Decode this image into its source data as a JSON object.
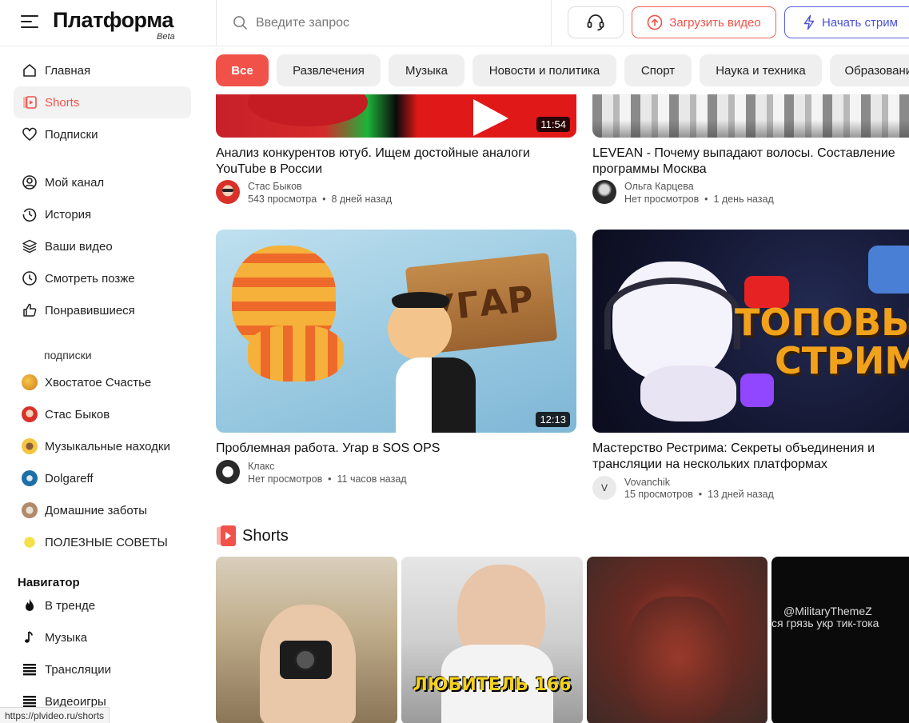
{
  "header": {
    "logo": "Платформа",
    "beta": "Beta",
    "search_placeholder": "Введите запрос",
    "upload_label": "Загрузить видео",
    "stream_label": "Начать стрим"
  },
  "sidebar": {
    "main_items": [
      {
        "label": "Главная",
        "icon": "home-icon"
      },
      {
        "label": "Shorts",
        "icon": "shorts-icon",
        "active": true
      },
      {
        "label": "Подписки",
        "icon": "heart-icon"
      }
    ],
    "library_items": [
      {
        "label": "Мой канал",
        "icon": "user-circle-icon"
      },
      {
        "label": "История",
        "icon": "history-icon"
      },
      {
        "label": "Ваши видео",
        "icon": "layers-icon"
      },
      {
        "label": "Смотреть позже",
        "icon": "clock-icon"
      },
      {
        "label": "Понравившиеся",
        "icon": "thumb-up-icon"
      }
    ],
    "subs_label": "подписки",
    "subscriptions": [
      {
        "label": "Хвостатое Счастье",
        "color": "#e8a020"
      },
      {
        "label": "Стас Быков",
        "color": "#d9302a"
      },
      {
        "label": "Музыкальные находки",
        "color": "#f4c542"
      },
      {
        "label": "Dolgareff",
        "color": "#1e6fa8"
      },
      {
        "label": "Домашние заботы",
        "color": "#c9a27a"
      },
      {
        "label": "ПОЛЕЗНЫЕ СОВЕТЫ",
        "color": "#f5e04a"
      }
    ],
    "navigator_label": "Навигатор",
    "navigator_items": [
      {
        "label": "В тренде",
        "icon": "flame-icon"
      },
      {
        "label": "Музыка",
        "icon": "music-note-icon"
      },
      {
        "label": "Трансляции",
        "icon": "broadcast-icon"
      },
      {
        "label": "Видеоигры",
        "icon": "gamepad-icon"
      }
    ]
  },
  "chips": [
    "Все",
    "Развлечения",
    "Музыка",
    "Новости и политика",
    "Спорт",
    "Наука и техника",
    "Образование"
  ],
  "videos": [
    {
      "title": "Анализ конкурентов ютуб. Ищем достойные аналоги YouTube в России",
      "author": "Стас Быков",
      "views": "543 просмотра",
      "age": "8 дней назад",
      "duration": "11:54"
    },
    {
      "title": "LEVEAN - Почему выпадают волосы. Составление программы Москва",
      "author": "Ольга Карцева",
      "views": "Нет просмотров",
      "age": "1 день назад",
      "duration": ""
    },
    {
      "title": "Проблемная работа. Угар в SOS OPS",
      "author": "Клакс",
      "views": "Нет просмотров",
      "age": "11 часов назад",
      "duration": "12:13",
      "thumb_text": "УГАР"
    },
    {
      "title": "Мастерство Рестрима: Секреты объединения и трансляции на нескольких платформах",
      "author": "Vovanchik",
      "avatar_letter": "V",
      "views": "15 просмотров",
      "age": "13 дней назад",
      "duration": "",
      "thumb_text_1": "ТОПОВЫ",
      "thumb_text_2": "СТРИМ"
    }
  ],
  "shorts": {
    "title": "Shorts",
    "items": [
      {
        "overlay": ""
      },
      {
        "overlay": "ЛЮБИТЕЛЬ 166"
      },
      {
        "overlay": ""
      },
      {
        "overlay": "@MilitaryThemeZ",
        "overlay2": "ся грязь укр тик-тока"
      }
    ]
  },
  "status_url": "https://plvideo.ru/shorts",
  "colors": {
    "accent": "#f0524a",
    "stream": "#4c51d6"
  }
}
